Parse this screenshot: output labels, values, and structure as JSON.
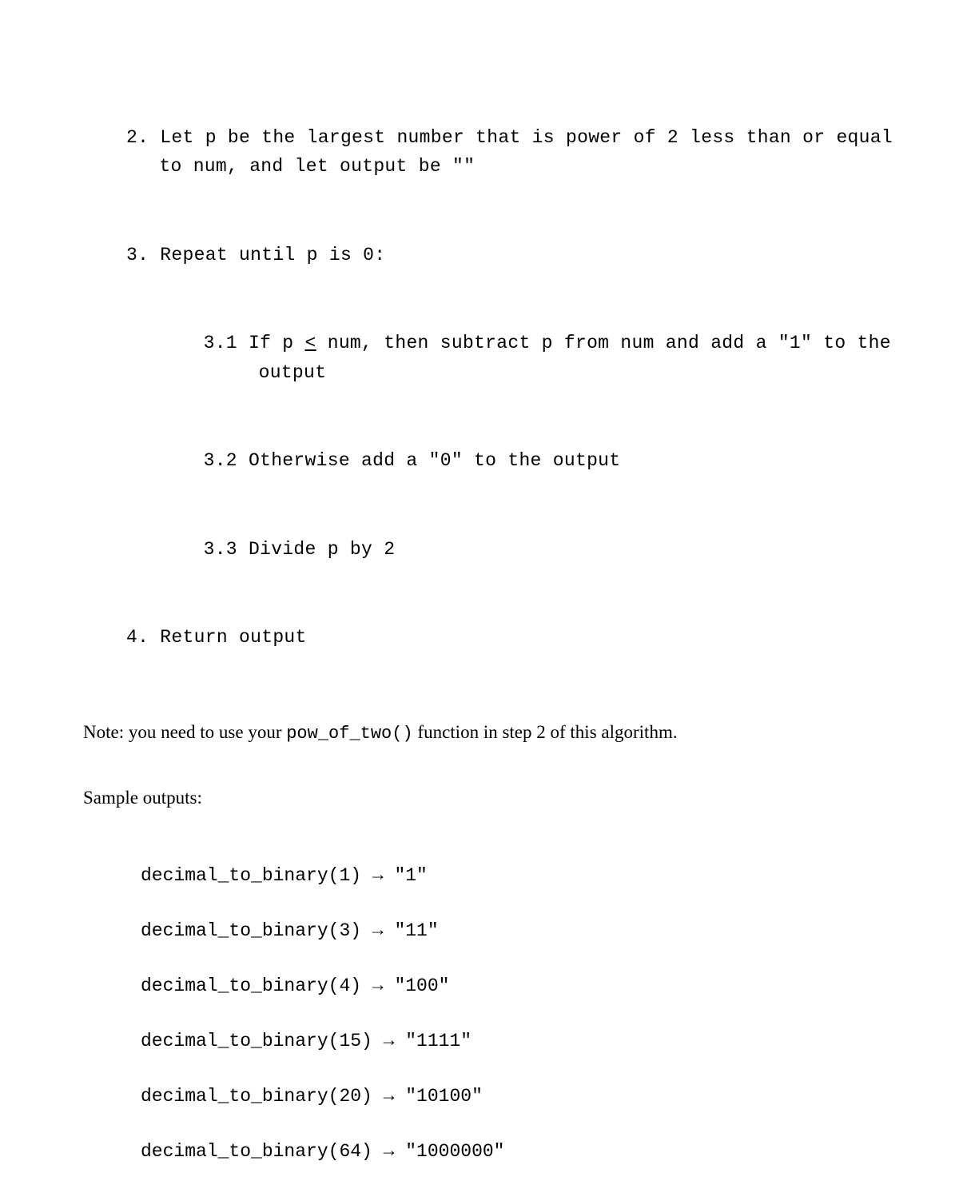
{
  "algorithm": {
    "step2": "2. Let p be the largest number that is power of 2 less than or equal to num, and let output be \"\"",
    "step3": "3. Repeat until p is 0:",
    "step3_1_pre": "3.1  If p ",
    "step3_1_le": "<",
    "step3_1_post": " num, then subtract p from num and add a \"1\" to the output",
    "step3_2": "3.2  Otherwise add a \"0\" to the output",
    "step3_3": "3.3  Divide p by 2",
    "step4": "4. Return output"
  },
  "note_pre": "Note: you need to use your ",
  "note_code": "pow_of_two()",
  "note_post": " function in step 2 of this algorithm.",
  "sample_heading": "Sample outputs:",
  "samples": [
    "decimal_to_binary(1) → \"1\"",
    "decimal_to_binary(3) → \"11\"",
    "decimal_to_binary(4) → \"100\"",
    "decimal_to_binary(15) → \"1111\"",
    "decimal_to_binary(20) → \"10100\"",
    "decimal_to_binary(64) → \"1000000\""
  ]
}
